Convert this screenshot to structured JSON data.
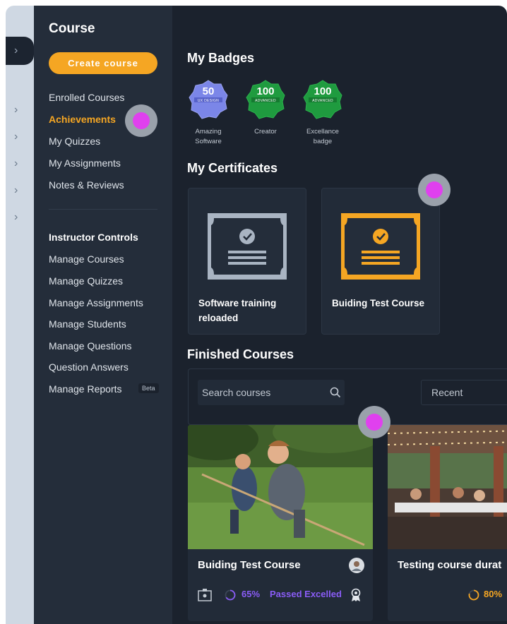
{
  "sidebar": {
    "title": "Course",
    "create_button": "Create course",
    "student_items": [
      "Enrolled Courses",
      "Achievements",
      "My Quizzes",
      "My Assignments",
      "Notes & Reviews"
    ],
    "instructor_heading": "Instructor Controls",
    "instructor_items": [
      "Manage Courses",
      "Manage Quizzes",
      "Manage Assignments",
      "Manage Students",
      "Manage Questions",
      "Question Answers",
      "Manage Reports"
    ],
    "beta_badge": "Beta"
  },
  "badges": {
    "heading": "My Badges",
    "items": [
      {
        "number": "50",
        "sub": "UX DESIGN",
        "label_line1": "Amazing",
        "label_line2": "Software",
        "color": "#7b86e8"
      },
      {
        "number": "100",
        "sub": "ADVANCED",
        "label_line1": "Creator",
        "label_line2": "",
        "color": "#1f9b3f"
      },
      {
        "number": "100",
        "sub": "ADVANCED",
        "label_line1": "Excellance",
        "label_line2": "badge",
        "color": "#1f9b3f"
      }
    ]
  },
  "certificates": {
    "heading": "My Certificates",
    "items": [
      {
        "title_line1": "Software training",
        "title_line2": "reloaded",
        "frame_color": "#a9b4c2"
      },
      {
        "title_line1": "Buiding Test Course",
        "title_line2": "",
        "frame_color": "#f5a623"
      }
    ]
  },
  "finished": {
    "heading": "Finished Courses",
    "search_placeholder": "Search courses",
    "sort_value": "Recent",
    "courses": [
      {
        "title": "Buiding Test Course",
        "progress": "65%",
        "status": "Passed Excelled",
        "progress_color": "#8a5cf6"
      },
      {
        "title": "Testing course durat",
        "progress": "80%",
        "status": "",
        "progress_color": "#f5a623"
      }
    ]
  },
  "colors": {
    "accent": "#f5a623",
    "hotspot": "#e040ee",
    "sidebar_bg": "#242d3a",
    "main_bg": "#1b222d"
  }
}
